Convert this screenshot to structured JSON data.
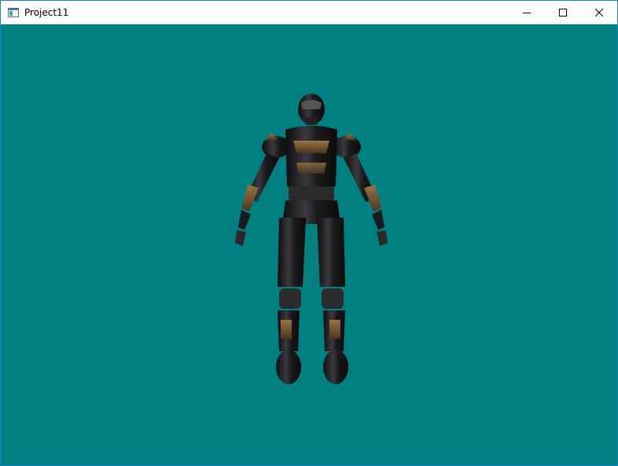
{
  "window": {
    "title": "Project11",
    "background_color": "#008080",
    "border_color": "#1883d7"
  },
  "titlebar": {
    "icon": "app-window-icon",
    "buttons": [
      {
        "name": "minimize",
        "icon": "minimize-icon"
      },
      {
        "name": "maximize",
        "icon": "maximize-icon"
      },
      {
        "name": "close",
        "icon": "close-icon"
      }
    ]
  },
  "viewport": {
    "content": "armored-soldier-3d-model",
    "model_colors": {
      "armor_dark": "#1c1c1e",
      "armor_accent": "#7a5a36"
    }
  }
}
